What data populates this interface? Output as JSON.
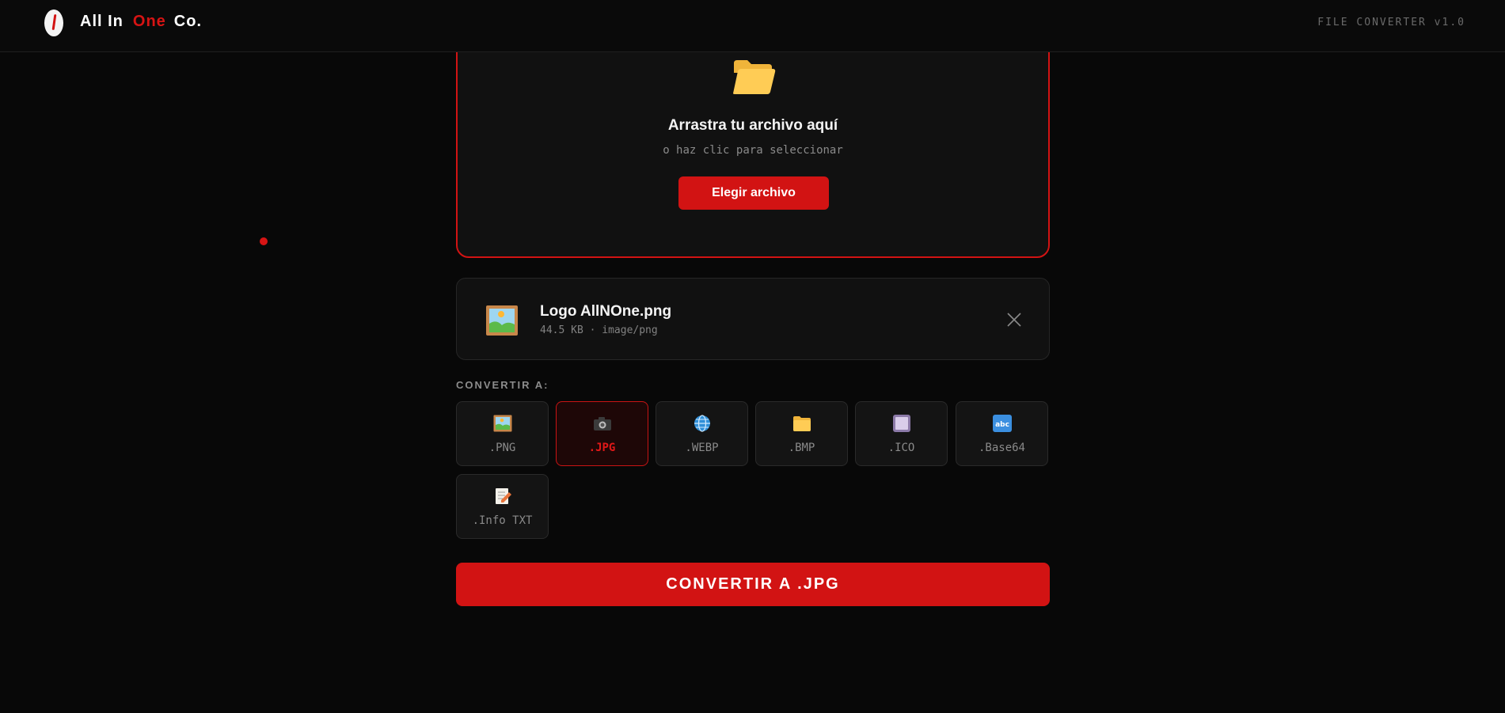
{
  "header": {
    "brand_word1": "All In",
    "brand_word2": "One",
    "brand_word3": "Co.",
    "version": "FILE CONVERTER v1.0"
  },
  "dropzone": {
    "title": "Arrastra tu archivo aquí",
    "subtitle": "o haz clic para seleccionar",
    "button_label": "Elegir archivo"
  },
  "file": {
    "name": "Logo AllNOne.png",
    "meta": "44.5 KB · image/png"
  },
  "convert": {
    "section_label": "CONVERTIR A:",
    "selected": ".JPG",
    "formats": [
      {
        "label": ".PNG",
        "icon": "framed-picture-icon"
      },
      {
        "label": ".JPG",
        "icon": "camera-icon"
      },
      {
        "label": ".WEBP",
        "icon": "globe-icon"
      },
      {
        "label": ".BMP",
        "icon": "folder-icon"
      },
      {
        "label": ".ICO",
        "icon": "square-icon"
      },
      {
        "label": ".Base64",
        "icon": "abc-icon"
      },
      {
        "label": ".Info TXT",
        "icon": "memo-icon"
      }
    ],
    "button_label": "CONVERTIR A .JPG"
  },
  "colors": {
    "accent": "#d21313",
    "background": "#080808",
    "card": "#111111"
  }
}
